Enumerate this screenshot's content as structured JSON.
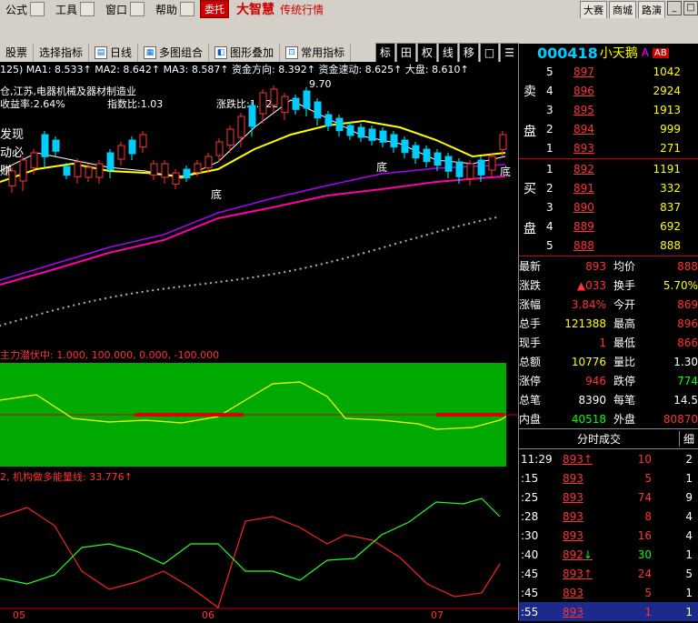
{
  "menubar": {
    "items": [
      "公式",
      "工具",
      "窗口",
      "帮助"
    ],
    "commission_label": "委托",
    "brand": "大智慧",
    "brand_sub": "传统行情",
    "right_buttons": [
      "大赛",
      "商城",
      "路演"
    ]
  },
  "toolbar": {
    "items": [
      "股票",
      "选择指标",
      "日线",
      "多图组合",
      "图形叠加",
      "常用指标"
    ],
    "right_items": [
      "标",
      "田",
      "权",
      "线",
      "移",
      "□",
      "☰"
    ]
  },
  "ticker": {
    "code": "000418",
    "name": "小天鹅",
    "flag": "A",
    "flag_alt": "AB"
  },
  "chart_header": {
    "ma_line": "125) MA1: 8.533↑ MA2: 8.642↑ MA3: 8.587↑ 资金方向: 8.392↑ 资金速动: 8.625↑ 大盘: 8.610↑",
    "info1": "仓,江苏,电器机械及器材制造业",
    "info2": "收益率:2.64%",
    "info3": "指数比:1.03",
    "info4": "涨跌比:1.122",
    "peak_label": "9.70",
    "bottom_labels": [
      "底",
      "底",
      "底"
    ],
    "left_text": [
      "发现",
      "动必",
      "赚"
    ]
  },
  "indicator1": {
    "label": "主力潜伏中: 1.000, 100.000, 0.000, -100.000"
  },
  "indicator2": {
    "label": "2, 机构做多能量线: 33.776↑"
  },
  "x_axis": {
    "labels": [
      "05",
      "06",
      "07"
    ]
  },
  "quote": {
    "sell_label": [
      "卖",
      "盘"
    ],
    "buy_label": [
      "买",
      "盘"
    ],
    "sells": [
      {
        "level": "5",
        "price": "897",
        "vol": "1042"
      },
      {
        "level": "4",
        "price": "896",
        "vol": "2924"
      },
      {
        "level": "3",
        "price": "895",
        "vol": "1913"
      },
      {
        "level": "2",
        "price": "894",
        "vol": "999"
      },
      {
        "level": "1",
        "price": "893",
        "vol": "271"
      }
    ],
    "buys": [
      {
        "level": "1",
        "price": "892",
        "vol": "1191"
      },
      {
        "level": "2",
        "price": "891",
        "vol": "332"
      },
      {
        "level": "3",
        "price": "890",
        "vol": "837"
      },
      {
        "level": "4",
        "price": "889",
        "vol": "692"
      },
      {
        "level": "5",
        "price": "888",
        "vol": "888"
      }
    ]
  },
  "info": [
    {
      "k": "最新",
      "v": "893",
      "k2": "均价",
      "v2": "888"
    },
    {
      "k": "涨跌",
      "v": "▲033",
      "k2": "换手",
      "v2": "5.70%"
    },
    {
      "k": "涨幅",
      "v": "3.84%",
      "k2": "今开",
      "v2": "869"
    },
    {
      "k": "总手",
      "v": "121388",
      "k2": "最高",
      "v2": "896"
    },
    {
      "k": "现手",
      "v": "1",
      "k2": "最低",
      "v2": "866"
    },
    {
      "k": "总额",
      "v": "10776",
      "k2": "量比",
      "v2": "1.30"
    },
    {
      "k": "涨停",
      "v": "946",
      "k2": "跌停",
      "v2": "774"
    },
    {
      "k": "总笔",
      "v": "8390",
      "k2": "每笔",
      "v2": "14.5"
    },
    {
      "k": "内盘",
      "v": "40518",
      "k2": "外盘",
      "v2": "80870"
    }
  ],
  "trades_header": {
    "title": "分时成交",
    "tab": "细"
  },
  "trades": [
    {
      "t": "11:29",
      "p": "893",
      "arrow": "↑",
      "q": "10",
      "n": "2",
      "qcolor": "red"
    },
    {
      "t": ":15",
      "p": "893",
      "arrow": "",
      "q": "5",
      "n": "1",
      "qcolor": "red"
    },
    {
      "t": ":25",
      "p": "893",
      "arrow": "",
      "q": "74",
      "n": "9",
      "qcolor": "red"
    },
    {
      "t": ":28",
      "p": "893",
      "arrow": "",
      "q": "8",
      "n": "4",
      "qcolor": "red"
    },
    {
      "t": ":30",
      "p": "893",
      "arrow": "",
      "q": "16",
      "n": "4",
      "qcolor": "red"
    },
    {
      "t": ":40",
      "p": "892",
      "arrow": "↓",
      "q": "30",
      "n": "1",
      "qcolor": "green"
    },
    {
      "t": ":45",
      "p": "893",
      "arrow": "↑",
      "q": "24",
      "n": "5",
      "qcolor": "red"
    },
    {
      "t": ":45",
      "p": "893",
      "arrow": "",
      "q": "5",
      "n": "1",
      "qcolor": "red"
    },
    {
      "t": ":55",
      "p": "893",
      "arrow": "",
      "q": "1",
      "n": "1",
      "qcolor": "red"
    }
  ]
}
